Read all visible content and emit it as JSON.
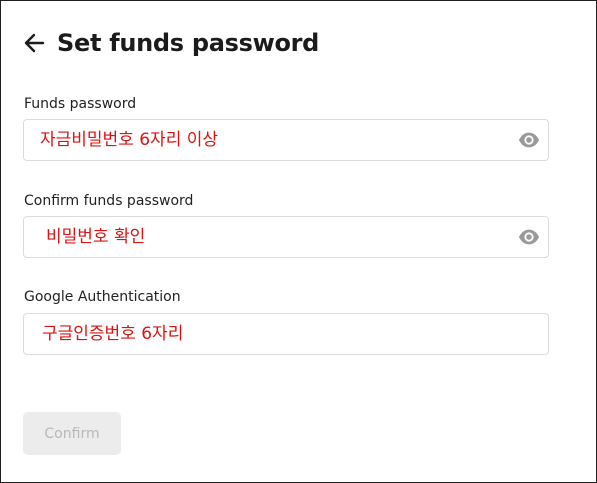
{
  "header": {
    "title": "Set funds password",
    "back_icon": "arrow-left-icon"
  },
  "fields": [
    {
      "label": "Funds password",
      "value": "자금비밀번호 6자리 이상",
      "icon": "eye-icon"
    },
    {
      "label": "Confirm funds password",
      "value": "비밀번호 확인",
      "icon": "eye-icon"
    },
    {
      "label": "Google Authentication",
      "value": "구글인증번호 6자리"
    }
  ],
  "actions": {
    "confirm_label": "Confirm",
    "confirm_state": "disabled"
  },
  "colors": {
    "annotation_text": "#d81414",
    "disabled_button_bg": "#ececec",
    "disabled_button_text": "#b8b8b8",
    "input_border": "#dcdcdc",
    "title_text": "#1b1b1b"
  }
}
